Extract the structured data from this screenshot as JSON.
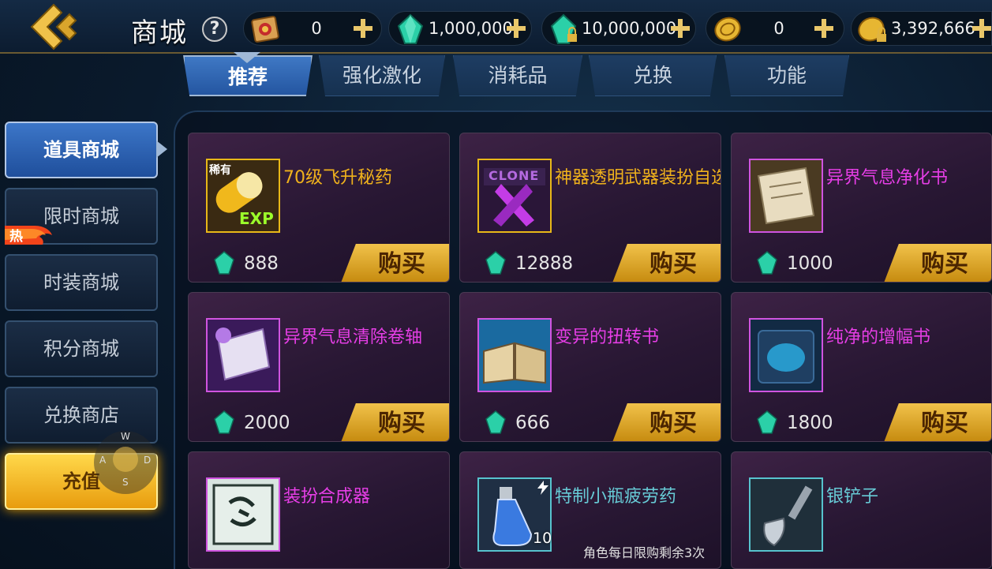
{
  "header": {
    "title": "商城",
    "help_label": "?",
    "back_icon": "back-arrow-icon",
    "currencies": [
      {
        "icon": "scroll-ticket-icon",
        "value": "0"
      },
      {
        "icon": "diamond-icon",
        "value": "1,000,000"
      },
      {
        "icon": "locked-diamond-icon",
        "value": "10,000,000"
      },
      {
        "icon": "gold-coin-icon",
        "value": "0"
      },
      {
        "icon": "locked-gold-coin-icon",
        "value": "3,392,666"
      }
    ]
  },
  "tabs": [
    {
      "label": "推荐",
      "active": true
    },
    {
      "label": "强化激化",
      "active": false
    },
    {
      "label": "消耗品",
      "active": false
    },
    {
      "label": "兑换",
      "active": false
    },
    {
      "label": "功能",
      "active": false
    }
  ],
  "sidebar": {
    "items": [
      {
        "label": "道具商城",
        "active": true
      },
      {
        "label": "限时商城",
        "badge": "热"
      },
      {
        "label": "时装商城"
      },
      {
        "label": "积分商城"
      },
      {
        "label": "兑换商店"
      },
      {
        "label": "充值"
      }
    ],
    "joystick": {
      "up": "W",
      "left": "A",
      "right": "D",
      "down": "S"
    }
  },
  "items": [
    {
      "name": "70级飞升秘药",
      "name_color": "#f0b21c",
      "price": "888",
      "buy_label": "购买",
      "icon": "exp-capsule-icon",
      "thumb_tag": "稀有",
      "thumb_text": "EXP"
    },
    {
      "name": "神器透明武器装扮自选",
      "name_color": "#f0b21c",
      "price": "12888",
      "buy_label": "购买",
      "icon": "clone-weapon-icon",
      "thumb_text": "CLONE"
    },
    {
      "name": "异界气息净化书",
      "name_color": "#e63ee6",
      "price": "1000",
      "buy_label": "购买",
      "icon": "parchment-scroll-icon"
    },
    {
      "name": "异界气息清除卷轴",
      "name_color": "#e63ee6",
      "price": "2000",
      "buy_label": "购买",
      "icon": "purple-scroll-icon"
    },
    {
      "name": "变异的扭转书",
      "name_color": "#e63ee6",
      "price": "666",
      "buy_label": "购买",
      "icon": "open-book-icon"
    },
    {
      "name": "纯净的增幅书",
      "name_color": "#e63ee6",
      "price": "1800",
      "buy_label": "购买",
      "icon": "blue-tome-icon"
    },
    {
      "name": "装扮合成器",
      "name_color": "#e63ee6",
      "icon": "avatar-synthesizer-icon"
    },
    {
      "name": "特制小瓶疲劳药",
      "name_color": "#67cbd6",
      "icon": "fatigue-potion-icon",
      "qty": "10",
      "limit_note": "角色每日限购剩余3次"
    },
    {
      "name": "银铲子",
      "name_color": "#67cbd6",
      "icon": "silver-shovel-icon"
    }
  ],
  "colors": {
    "accent_gold": "#f1c24a",
    "tab_active": "#3f78c4",
    "card_bg": "#2d1a3a"
  }
}
